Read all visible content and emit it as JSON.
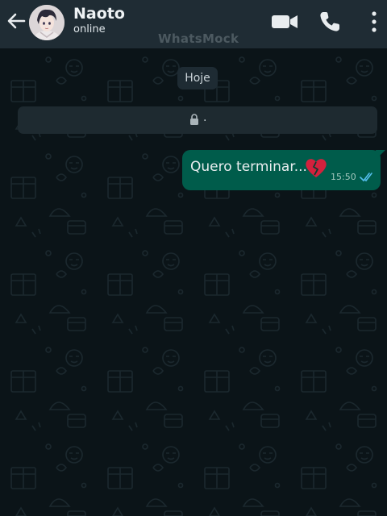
{
  "header": {
    "contact_name": "Naoto",
    "status": "online",
    "watermark": "WhatsMock",
    "icons": [
      "back-arrow-icon",
      "video-call-icon",
      "phone-call-icon",
      "more-options-icon"
    ]
  },
  "chat": {
    "date_chip": "Hoje",
    "notice": {
      "icon": "lock-icon",
      "text": "."
    },
    "messages": [
      {
        "direction": "outgoing",
        "text": "Quero terminar...",
        "emoji": "broken-heart-icon",
        "time": "15:50",
        "status": "read"
      }
    ]
  },
  "colors": {
    "header_bg": "#1f2c34",
    "chat_bg": "#0b1418",
    "outgoing_bubble": "#005c4b",
    "read_ticks": "#53bdeb"
  }
}
